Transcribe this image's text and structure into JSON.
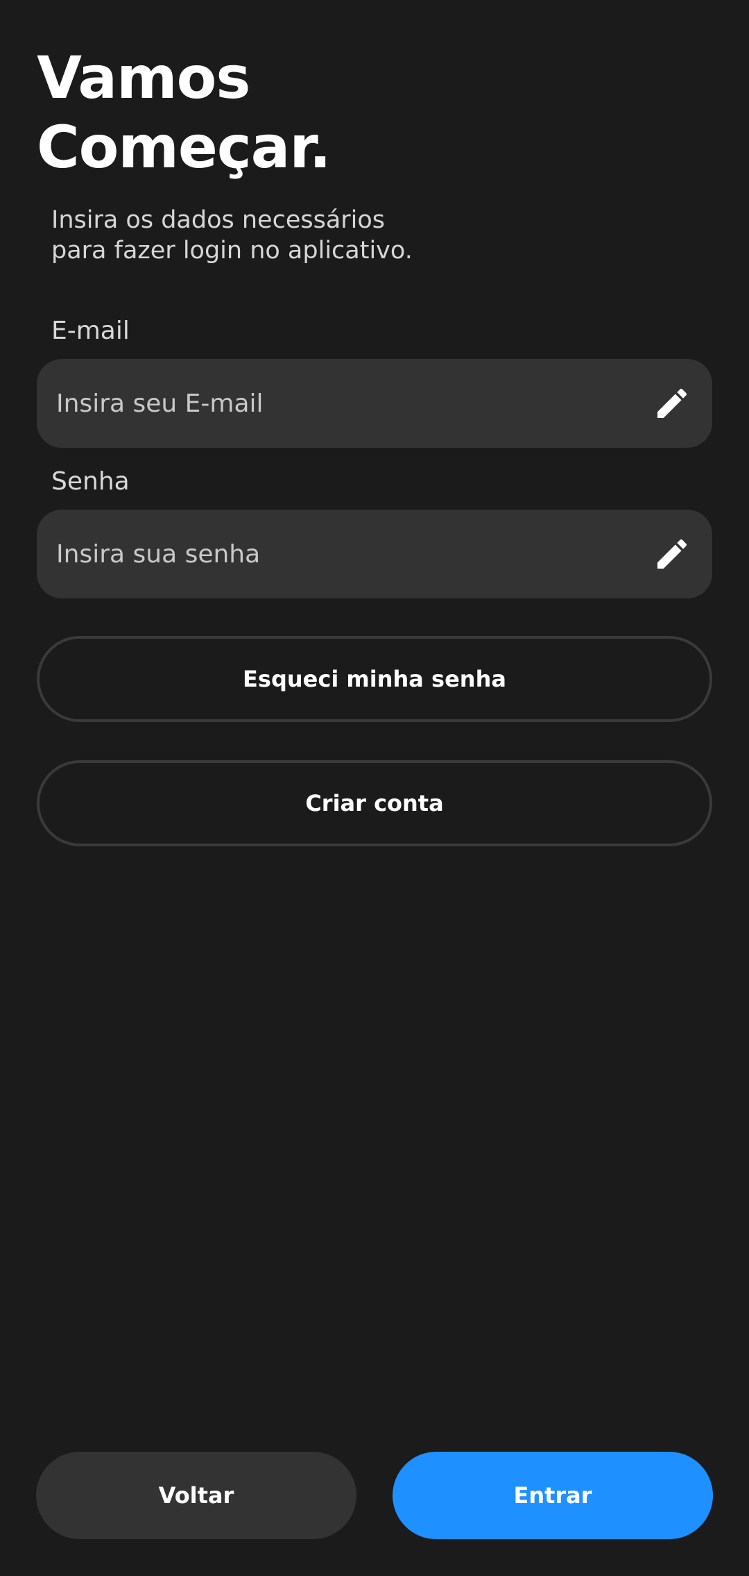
{
  "header": {
    "title_line1": "Vamos",
    "title_line2": "Começar.",
    "subtitle_line1": "Insira os dados necessários",
    "subtitle_line2": "para fazer login no aplicativo."
  },
  "form": {
    "email": {
      "label": "E-mail",
      "value": "",
      "placeholder": "Insira seu E-mail",
      "icon": "pencil-edit-icon"
    },
    "password": {
      "label": "Senha",
      "value": "",
      "placeholder": "Insira sua senha",
      "icon": "pencil-edit-icon"
    }
  },
  "links": {
    "forgot_password": "Esqueci minha senha",
    "create_account": "Criar conta"
  },
  "actions": {
    "back_label": "Voltar",
    "enter_label": "Entrar"
  },
  "colors": {
    "background": "#1b1b1b",
    "input_background": "#333333",
    "accent": "#1e90ff",
    "outline": "#3a3a3a"
  }
}
